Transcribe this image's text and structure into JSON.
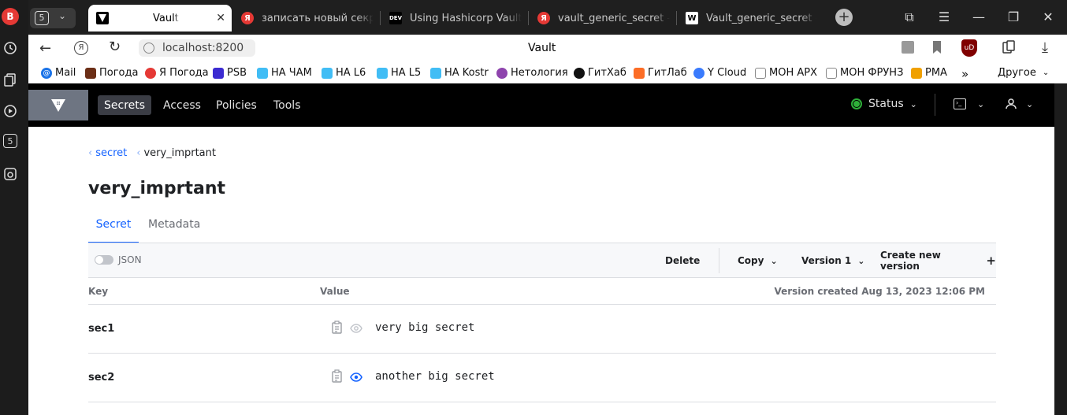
{
  "browser": {
    "sidebar_profile_letter": "B",
    "tab_count": "5",
    "tabs": [
      {
        "title": "Vault",
        "active": true
      },
      {
        "title": "записать новый секрет",
        "active": false
      },
      {
        "title": "Using Hashicorp Vault to",
        "active": false
      },
      {
        "title": "vault_generic_secret —",
        "active": false
      },
      {
        "title": "Vault_generic_secret - T",
        "active": false
      }
    ],
    "address": "localhost:8200",
    "page_title": "Vault",
    "bookmarks": [
      {
        "label": "Mail",
        "color": "#1a73e8"
      },
      {
        "label": "Погода",
        "color": "#6b2e16"
      },
      {
        "label": "Я Погода",
        "color": "#e53935"
      },
      {
        "label": "PSB",
        "color": "#3c2bd1"
      },
      {
        "label": "НА ЧАМ",
        "color": "#41bdf5"
      },
      {
        "label": "НА L6",
        "color": "#41bdf5"
      },
      {
        "label": "НА L5",
        "color": "#41bdf5"
      },
      {
        "label": "НА Kostr",
        "color": "#41bdf5"
      },
      {
        "label": "Нетология",
        "color": "#8e44ad"
      },
      {
        "label": "ГитХаб",
        "color": "#111111"
      },
      {
        "label": "ГитЛаб",
        "color": "#fc6d26"
      },
      {
        "label": "Y Cloud",
        "color": "#3a7bfd"
      },
      {
        "label": "МОН АРХ",
        "color": "#888888"
      },
      {
        "label": "МОН ФРУНЗ",
        "color": "#888888"
      },
      {
        "label": "PMA",
        "color": "#f0a000"
      }
    ],
    "bookmarks_more": "»",
    "bookmarks_other": "Другое"
  },
  "vault": {
    "nav": [
      "Secrets",
      "Access",
      "Policies",
      "Tools"
    ],
    "status_label": "Status",
    "breadcrumb": [
      "secret",
      "very_imprtant"
    ],
    "title": "very_imprtant",
    "tabs": [
      "Secret",
      "Metadata"
    ],
    "toolbar": {
      "json_label": "JSON",
      "delete": "Delete",
      "copy": "Copy",
      "version": "Version 1",
      "create": "Create new version"
    },
    "table": {
      "key_header": "Key",
      "value_header": "Value",
      "version_created": "Version created Aug 13, 2023 12:06 PM",
      "rows": [
        {
          "key": "sec1",
          "value": "very big secret",
          "revealed": false
        },
        {
          "key": "sec2",
          "value": "another big secret",
          "revealed": true
        }
      ]
    }
  },
  "colors": {
    "accent": "#1563ff",
    "status_ok": "#2eb039"
  }
}
